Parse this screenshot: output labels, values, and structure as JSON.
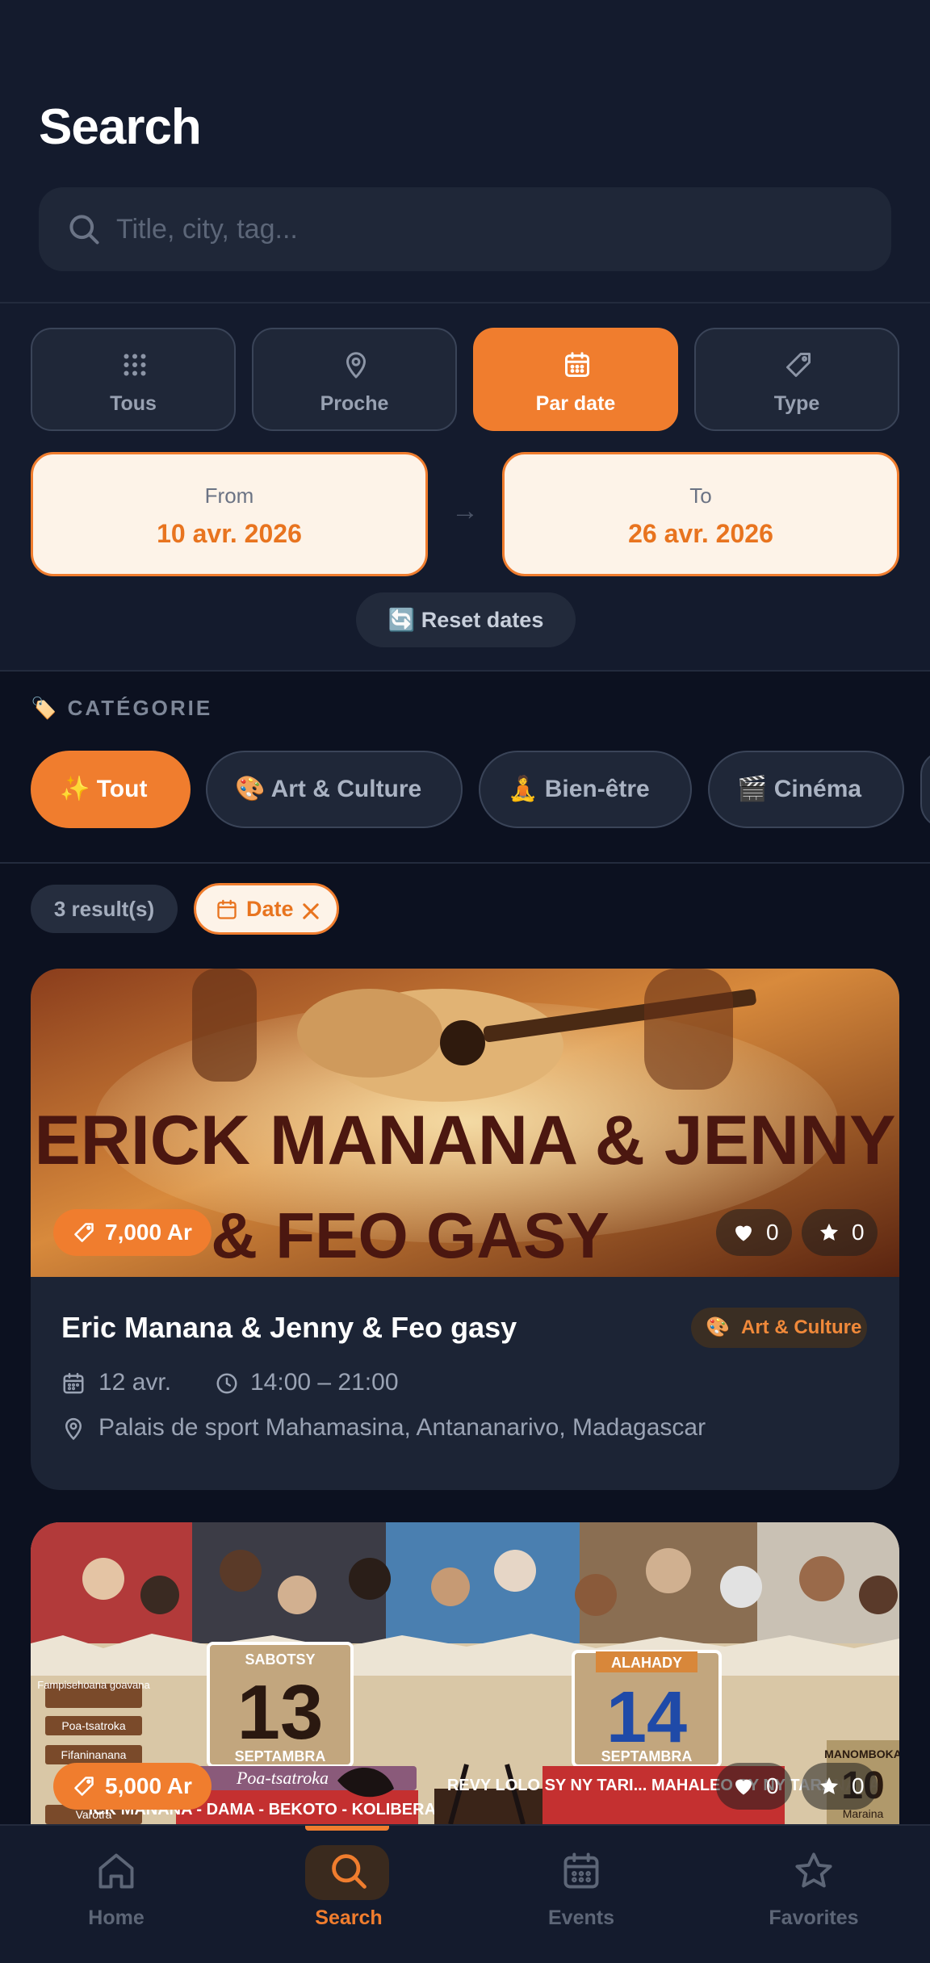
{
  "header": {
    "title": "Search"
  },
  "search": {
    "placeholder": "Title, city, tag..."
  },
  "tabs": [
    {
      "label": "Tous",
      "icon": "grid-icon"
    },
    {
      "label": "Proche",
      "icon": "map-pin-icon"
    },
    {
      "label": "Par date",
      "icon": "calendar-icon",
      "active": true
    },
    {
      "label": "Type",
      "icon": "tag-icon"
    }
  ],
  "date_range": {
    "from_label": "From",
    "from_value": "10 avr. 2026",
    "arrow": "→",
    "to_label": "To",
    "to_value": "26 avr. 2026",
    "reset_label": "🔄 Reset dates"
  },
  "category": {
    "heading": "🏷️ CATÉGORIE",
    "chips": [
      {
        "label": "✨ Tout",
        "active": true
      },
      {
        "label": "🎨 Art & Culture"
      },
      {
        "label": "🧘 Bien-être"
      },
      {
        "label": "🎬 Cinéma"
      }
    ]
  },
  "results": {
    "count_label": "3 result(s)",
    "active_filter_label": "Date"
  },
  "events": [
    {
      "banner_text": [
        "ERICK MANANA  & JENNY",
        "& FEO GASY"
      ],
      "price": "7,000 Ar",
      "likes": "0",
      "stars": "0",
      "title": "Eric Manana & Jenny & Feo gasy",
      "category_emoji": "🎨",
      "category": "Art & Culture",
      "date": "12 avr.",
      "time": "14:00 – 21:00",
      "location": "Palais de sport Mahamasina, Antananarivo, Madagascar"
    },
    {
      "poster": {
        "left_date_day": "SABOTSY",
        "left_date_num": "13",
        "left_date_month": "SEPTAMBRA",
        "right_date_day": "ALAHADY",
        "right_date_num": "14",
        "right_date_month": "SEPTAMBRA",
        "side_labels": [
          "Fampisehoana goavana",
          "Poa-tsatroka",
          "Fifaninanana",
          "Varotra"
        ],
        "left_script": "Poa-tsatroka",
        "left_lineup": "ICK MANANA - DAMA - BEKOTO - KOLIBERA - NJILA -",
        "right_lineup": "REVY LOLO SY NY TARI... MAHALEO SY NY TARANAKA",
        "corner_text": "MANOMBOKA",
        "corner_num": "10",
        "corner_sub": "Maraina"
      },
      "price": "5,000 Ar",
      "likes": "0",
      "stars": "0"
    }
  ],
  "nav": [
    {
      "label": "Home",
      "icon": "home-icon"
    },
    {
      "label": "Search",
      "icon": "search-icon",
      "active": true
    },
    {
      "label": "Events",
      "icon": "calendar-icon"
    },
    {
      "label": "Favorites",
      "icon": "star-icon"
    }
  ],
  "colors": {
    "accent": "#f07d2e",
    "background": "#0c1120",
    "surface": "#1c2435",
    "date_fill": "#fdf3e8"
  }
}
